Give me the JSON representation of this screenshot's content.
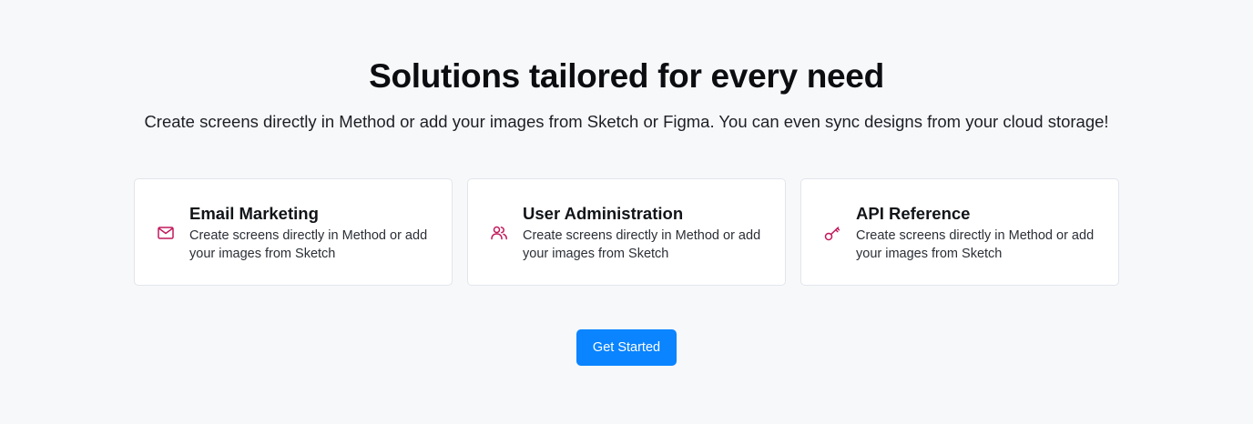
{
  "hero": {
    "title": "Solutions tailored for every need",
    "subtitle": "Create screens directly in Method or add your images from Sketch or Figma. You can even sync designs from your cloud storage!"
  },
  "accent_color": "#c2185b",
  "features": [
    {
      "icon": "mail-icon",
      "title": "Email Marketing",
      "description": "Create screens directly in Method or add your images from Sketch"
    },
    {
      "icon": "users-icon",
      "title": "User Administration",
      "description": "Create screens directly in Method or add your images from Sketch"
    },
    {
      "icon": "key-icon",
      "title": "API Reference",
      "description": "Create screens directly in Method or add your images from Sketch"
    }
  ],
  "cta": {
    "label": "Get Started",
    "color": "#0a84ff"
  }
}
